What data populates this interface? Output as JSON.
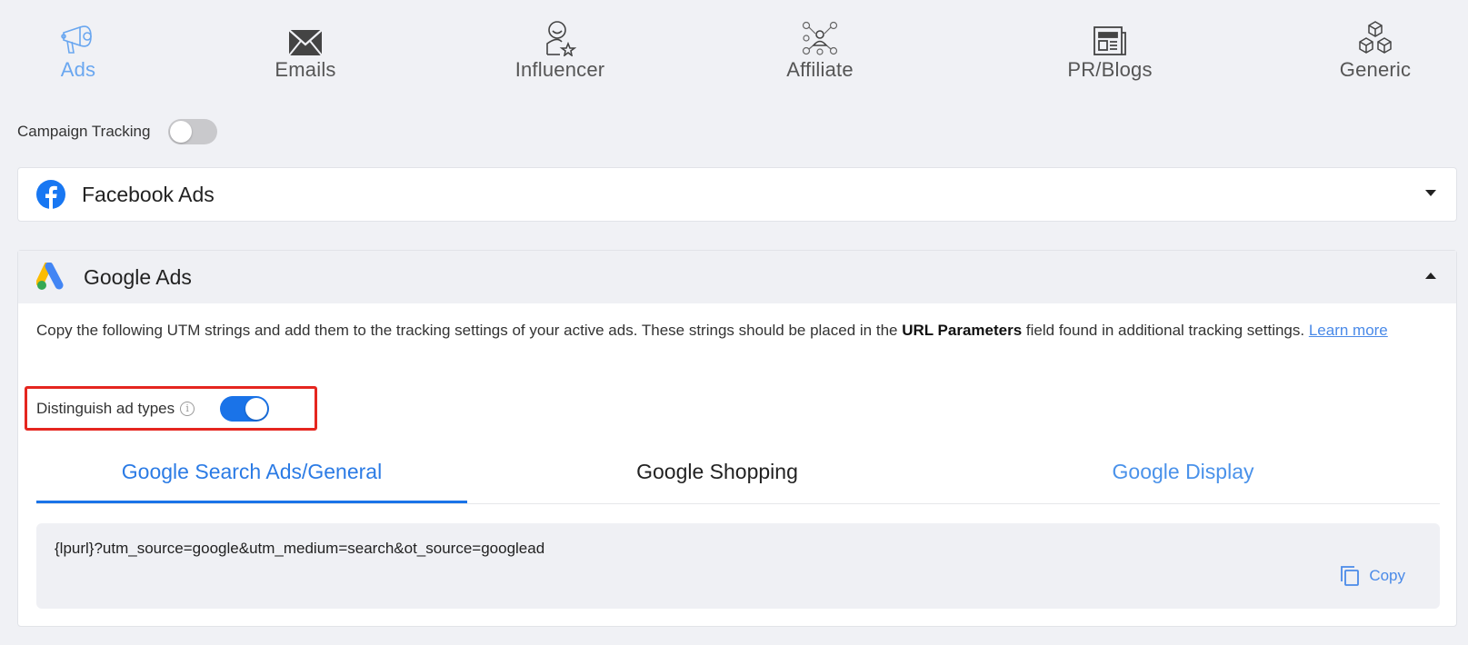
{
  "channels": [
    {
      "label": "Ads",
      "icon": "megaphone-icon",
      "active": true
    },
    {
      "label": "Emails",
      "icon": "envelope-icon"
    },
    {
      "label": "Influencer",
      "icon": "influencer-icon"
    },
    {
      "label": "Affiliate",
      "icon": "affiliate-network-icon"
    },
    {
      "label": "PR/Blogs",
      "icon": "newspaper-icon"
    },
    {
      "label": "Generic",
      "icon": "boxes-icon"
    }
  ],
  "campaign_tracking": {
    "label": "Campaign Tracking",
    "enabled": false
  },
  "facebook": {
    "title": "Facebook Ads",
    "icon": "facebook-icon"
  },
  "google": {
    "title": "Google Ads",
    "icon": "google-ads-icon",
    "description_part1": "Copy the following UTM strings and add them to the tracking settings of your active ads. These strings should be placed in the ",
    "description_bold": "URL Parameters",
    "description_part2": " field found in additional tracking settings. ",
    "learn_more": "Learn more",
    "distinguish": {
      "label": "Distinguish ad types",
      "info": "i",
      "enabled": true
    },
    "tabs": [
      {
        "label": "Google Search Ads/General",
        "active": true
      },
      {
        "label": "Google Shopping"
      },
      {
        "label": "Google Display"
      }
    ],
    "utm_string": "{lpurl}?utm_source=google&utm_medium=search&ot_source=googlead",
    "copy_label": "Copy"
  },
  "colors": {
    "accent": "#1a73e8",
    "highlight_border": "#e5261f",
    "link": "#4a8ae8"
  }
}
